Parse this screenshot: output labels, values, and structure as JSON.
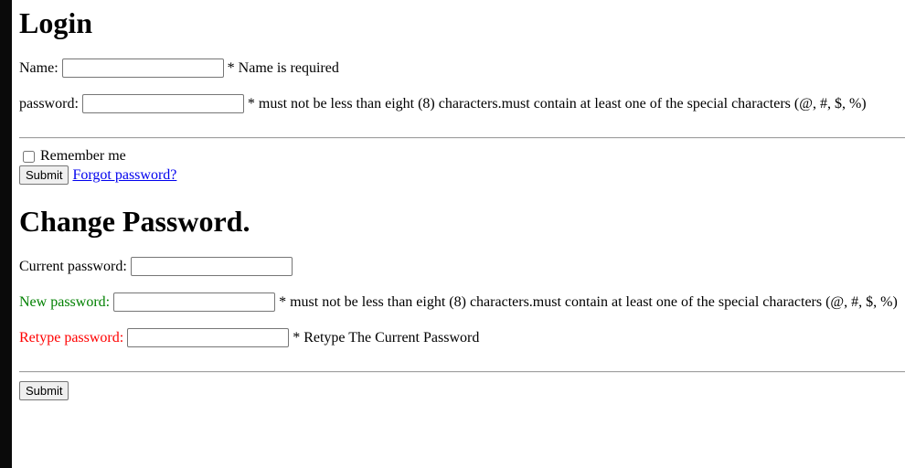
{
  "login": {
    "title": "Login",
    "name_label": "Name:",
    "name_hint": "* Name is required",
    "password_label": "password:",
    "password_hint": "* must not be less than eight (8) characters.must contain at least one of the special characters (@, #, $, %)",
    "remember_label": "Remember me",
    "submit_label": "Submit",
    "forgot_link": "Forgot password?"
  },
  "change": {
    "title": "Change Password.",
    "current_label": "Current password:",
    "new_label": "New password:",
    "new_hint": "* must not be less than eight (8) characters.must contain at least one of the special characters (@, #, $, %)",
    "retype_label": "Retype password:",
    "retype_hint": "* Retype The Current Password",
    "submit_label": "Submit"
  },
  "colors": {
    "new_label": "#008000",
    "retype_label": "#ff0000"
  }
}
